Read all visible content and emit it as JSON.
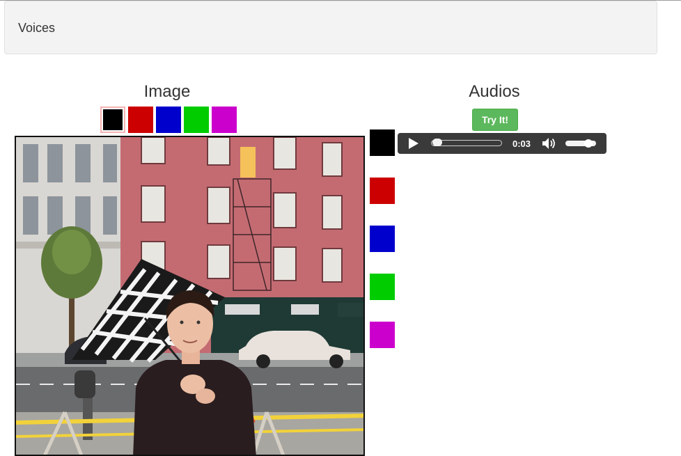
{
  "navbar": {
    "brand": "Voices"
  },
  "image_panel": {
    "heading": "Image",
    "swatches": [
      {
        "name": "black",
        "color": "#000000",
        "selected": true
      },
      {
        "name": "red",
        "color": "#cc0000"
      },
      {
        "name": "blue",
        "color": "#0000cc"
      },
      {
        "name": "green",
        "color": "#00cc00"
      },
      {
        "name": "magenta",
        "color": "#cc00cc"
      }
    ]
  },
  "audio_panel": {
    "heading": "Audios",
    "try_button": "Try It!",
    "voices": [
      {
        "name": "black",
        "color": "#000000",
        "has_player": true
      },
      {
        "name": "red",
        "color": "#cc0000"
      },
      {
        "name": "blue",
        "color": "#0000cc"
      },
      {
        "name": "green",
        "color": "#00cc00"
      },
      {
        "name": "magenta",
        "color": "#cc00cc"
      }
    ],
    "player": {
      "time": "0:03",
      "progress": 0.0,
      "volume": 0.85,
      "play_icon": "play-icon",
      "volume_icon": "speaker-icon"
    }
  }
}
